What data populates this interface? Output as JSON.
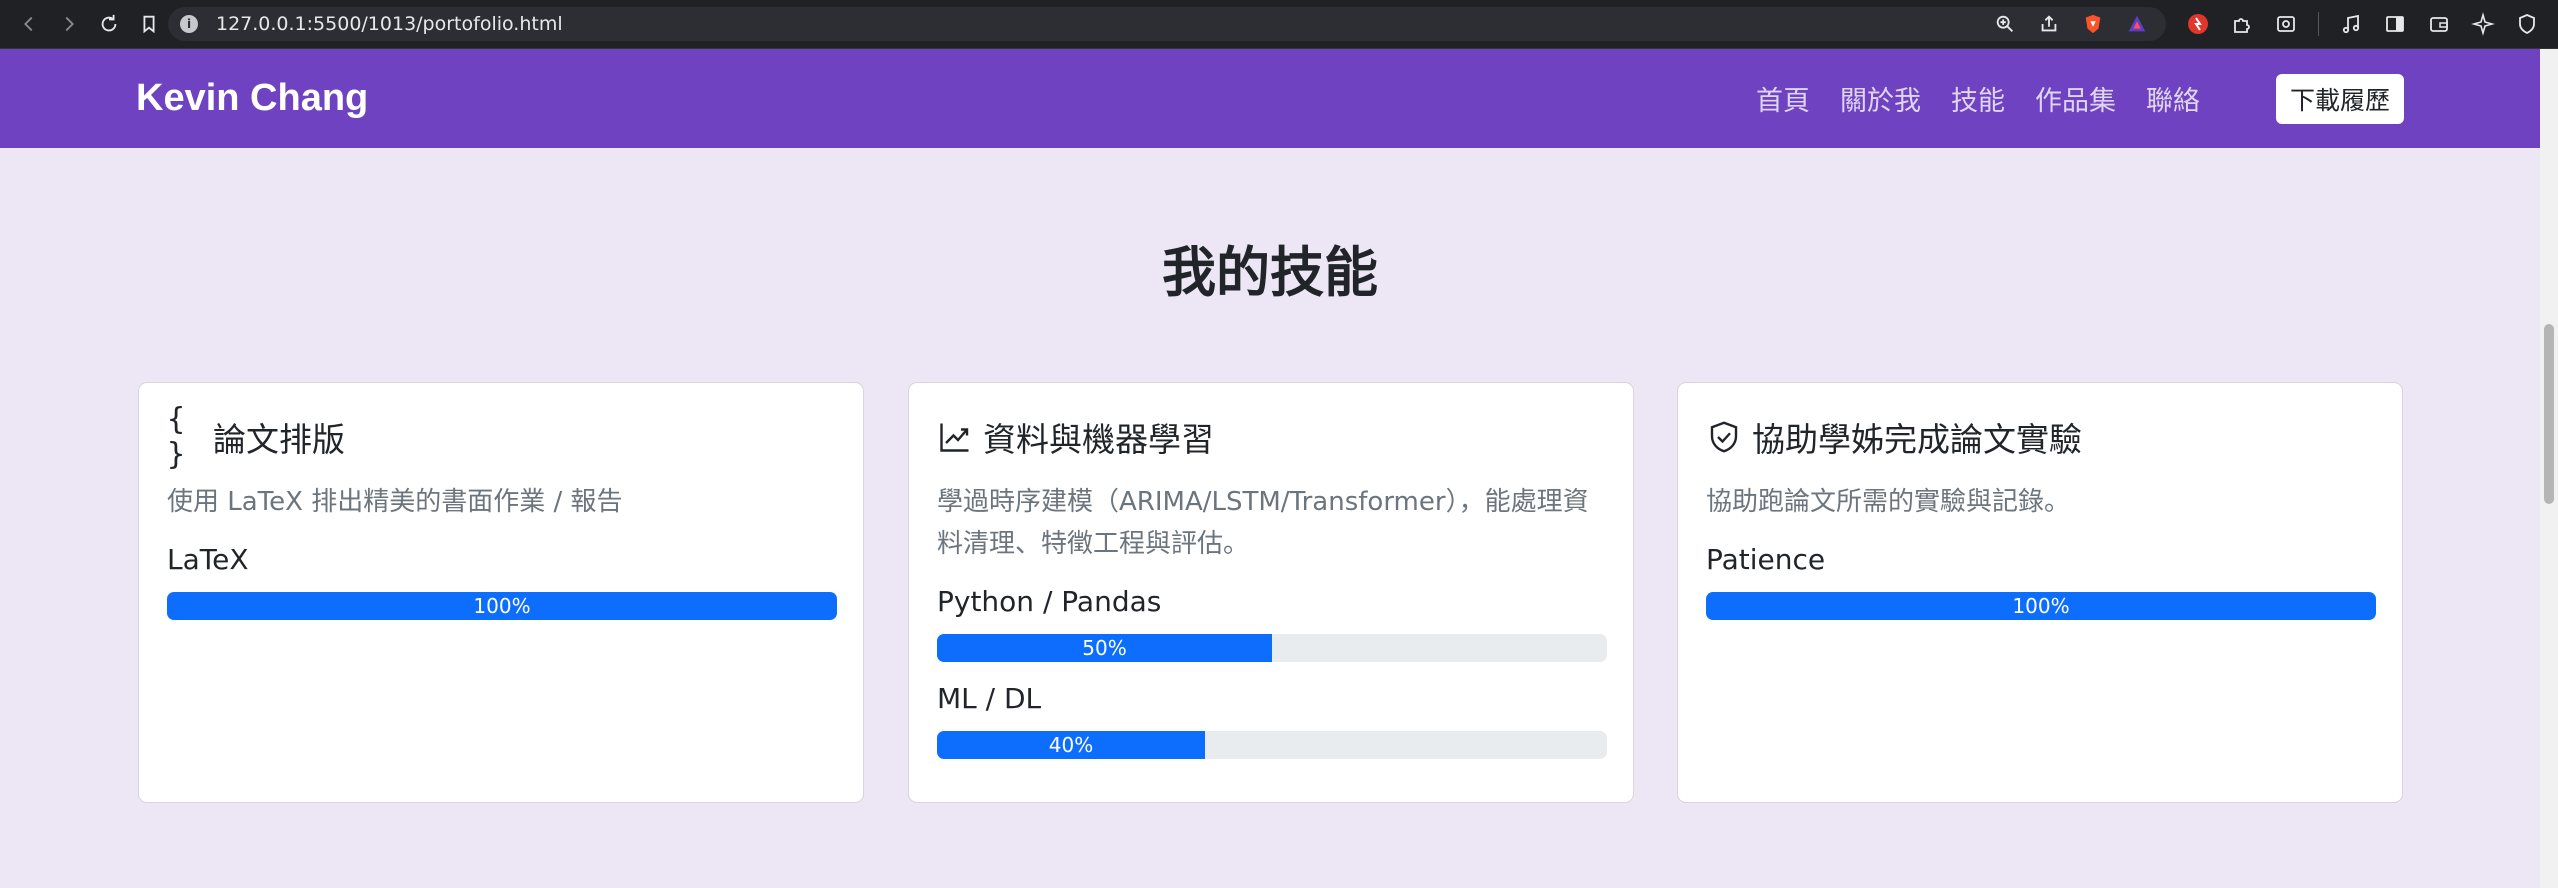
{
  "browser": {
    "url": "127.0.0.1:5500/1013/portofolio.html"
  },
  "navbar": {
    "brand": "Kevin Chang",
    "links": [
      "首頁",
      "關於我",
      "技能",
      "作品集",
      "聯絡"
    ],
    "download_label": "下載履歷",
    "bg_color": "#6f42c1"
  },
  "skills": {
    "title": "我的技能",
    "cards": [
      {
        "icon": "braces-icon",
        "icon_text": "{ }",
        "title": "論文排版",
        "desc": "使用 LaTeX 排出精美的書面作業 / 報告",
        "skills": [
          {
            "label": "LaTeX",
            "value": 100,
            "text": "100%"
          }
        ]
      },
      {
        "icon": "chart-line-icon",
        "title": "資料與機器學習",
        "desc": "學過時序建模（ARIMA/LSTM/Transformer），能處理資料清理、特徵工程與評估。",
        "skills": [
          {
            "label": "Python / Pandas",
            "value": 50,
            "text": "50%"
          },
          {
            "label": "ML / DL",
            "value": 40,
            "text": "40%"
          }
        ]
      },
      {
        "icon": "shield-check-icon",
        "title": "協助學姊完成論文實驗",
        "desc": "協助跑論文所需的實驗與記錄。",
        "skills": [
          {
            "label": "Patience",
            "value": 100,
            "text": "100%"
          }
        ]
      }
    ],
    "bar_color": "#0d6efd"
  }
}
